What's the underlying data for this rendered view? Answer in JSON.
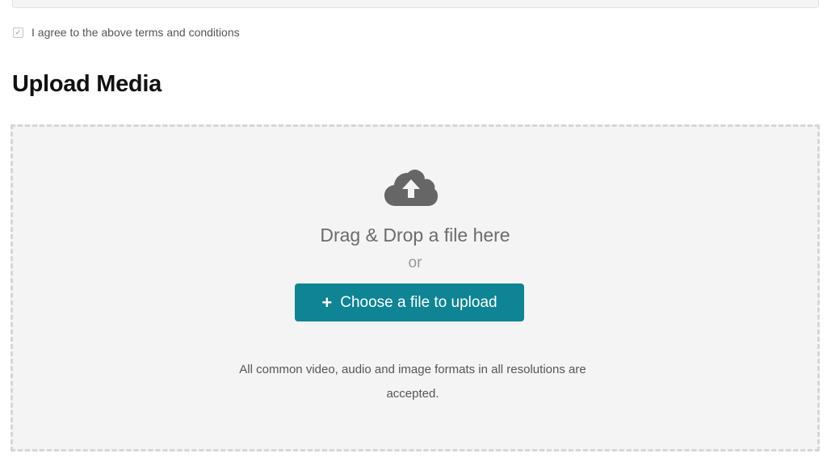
{
  "terms": {
    "agree_checked": true,
    "agree_label": "I agree to the above terms and conditions",
    "checkmark": "✓"
  },
  "upload": {
    "title": "Upload Media",
    "icon": "cloud-upload-icon",
    "drag_text": "Drag & Drop a file here",
    "or_text": "or",
    "button_icon": "+",
    "button_label": "Choose a file to upload",
    "button_color": "#0e8494",
    "formats_text": "All common video, audio and image formats in all resolutions are accepted."
  }
}
